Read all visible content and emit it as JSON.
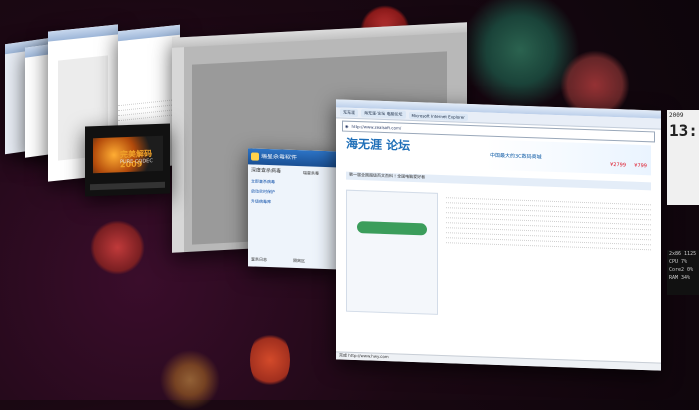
{
  "app": {
    "desktop": "Flip 3D window switcher"
  },
  "ie": {
    "title": "海无涯·论坛 - Internet Explorer",
    "tab_home": "无无涯",
    "tab_forum": "海无涯·论坛 电脑论坛",
    "tab_other": "Microsoft Internet Explorer",
    "address": "http://www.zealsoft.com/",
    "logo_text": "海无涯 论坛",
    "banner_text": "中国最大的3C数码商城",
    "banner_price1": "¥2799",
    "banner_price2": "¥799",
    "announce": "第一届全国超级百文百科 ! 全国电脑爱好者",
    "status_text": "完成 http://www.hwy.com"
  },
  "security_app": {
    "title": "瑞星杀毒软件",
    "header_text": "深度查杀病毒",
    "button1": "立即查杀病毒",
    "button2": "启动实时保护",
    "button3": "升级病毒库",
    "panel_title": "瑞星杀毒",
    "footer_left": "查杀日志",
    "footer_right": "隔离区"
  },
  "media_player": {
    "title": "完美解码 2009",
    "subtitle": "PURE CODEC"
  },
  "sidebar_gadget": {
    "clock_label": "2009",
    "time": "13:",
    "cpu": "CPU 7%",
    "line_a": "Core1",
    "line_b": "Core2 0%",
    "ram": "RAM 34%",
    "res": "2x86 1125"
  }
}
